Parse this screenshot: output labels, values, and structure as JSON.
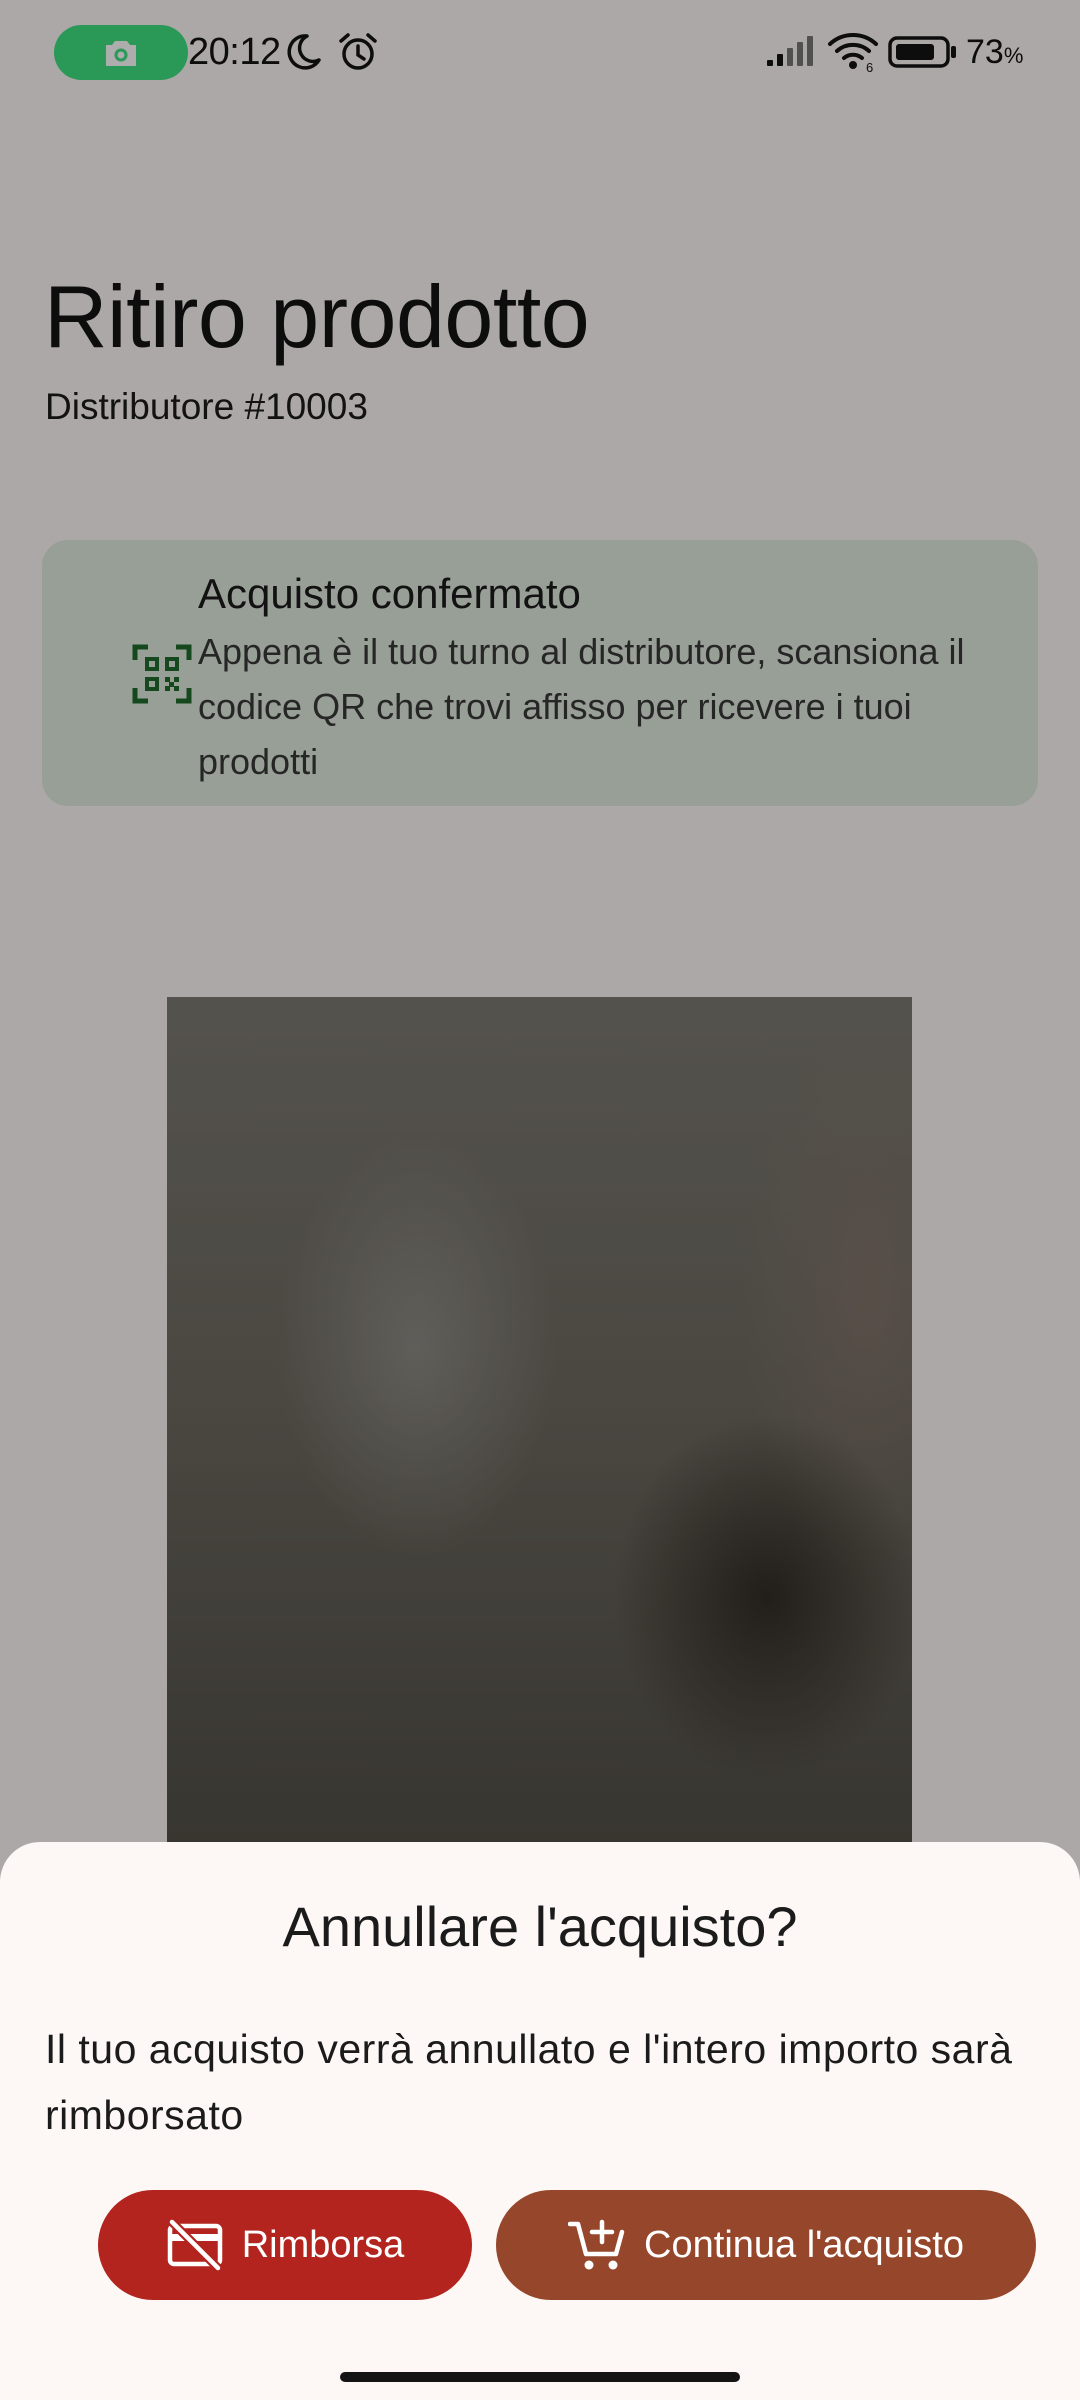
{
  "status_bar": {
    "time": "20:12",
    "battery_percent": "73",
    "battery_unit": "%",
    "wifi_band": "6",
    "icons": [
      "camera-icon",
      "moon-icon",
      "alarm-icon",
      "signal-icon",
      "wifi-icon",
      "battery-icon"
    ],
    "pill_color": "#3ee07f"
  },
  "page": {
    "title": "Ritiro prodotto",
    "subtitle": "Distributore #10003"
  },
  "info_card": {
    "icon": "qr-scanner-icon",
    "title": "Acquisto confermato",
    "body": "Appena è il tuo turno al distributore, scansiona il codice QR che trovi affisso per ricevere i tuoi prodotti",
    "background": "#e1ebde",
    "icon_color": "#1f6a2a"
  },
  "dialog": {
    "title": "Annullare l'acquisto?",
    "message": "Il tuo acquisto verrà annullato e l'intero importo sarà rimborsato",
    "refund_label": "Rimborsa",
    "refund_icon": "card-off-icon",
    "refund_color": "#b3241e",
    "continue_label": "Continua l'acquisto",
    "continue_icon": "add-shopping-cart-icon",
    "continue_color": "#96472b"
  }
}
